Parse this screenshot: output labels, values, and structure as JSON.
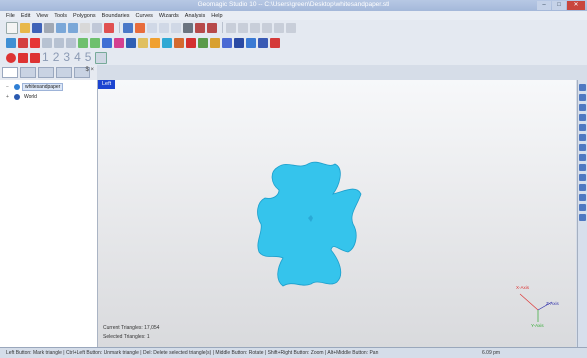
{
  "window": {
    "title": "Geomagic Studio 10 -- C:\\Users\\green\\Desktop\\whitesandpaper.stl",
    "minimize": "–",
    "maximize": "□",
    "close": "✕"
  },
  "menu": [
    "File",
    "Edit",
    "View",
    "Tools",
    "Polygons",
    "Boundaries",
    "Curves",
    "Wizards",
    "Analysis",
    "Help"
  ],
  "toolbar": {
    "numbers": [
      "1",
      "2",
      "3",
      "4",
      "5"
    ]
  },
  "model_manager": {
    "pin_label": "$ ×",
    "items": [
      {
        "label": "whitesandpaper",
        "selected": true,
        "expand": "−"
      },
      {
        "label": "World",
        "selected": false,
        "expand": "+"
      }
    ]
  },
  "viewport": {
    "view_label": "Left",
    "stats": {
      "current_triangles": "Current Triangles: 17,054",
      "selected_triangles": "Selected Triangles: 1"
    },
    "axes": {
      "x": "X-Axis",
      "z": "Z-Axis",
      "y": "Y-Axis"
    },
    "model_color": "#35c4ec"
  },
  "status": {
    "message": "Left Button: Mark triangle | Ctrl+Left Button: Unmark triangle | Del: Delete selected triangle(s) | Middle Button: Rotate | Shift+Right Button: Zoom | Alt+Middle Button: Pan",
    "units": "6.09 pm"
  }
}
